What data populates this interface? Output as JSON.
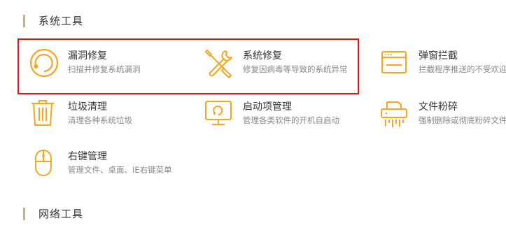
{
  "sections": {
    "system": {
      "title": "系统工具"
    },
    "network": {
      "title": "网络工具"
    }
  },
  "accent_color": "#f5a623",
  "highlight_color": "#e01515",
  "tools": [
    {
      "name": "漏洞修复",
      "desc": "扫描并修复系统漏洞",
      "icon": "refresh-ring-icon"
    },
    {
      "name": "系统修复",
      "desc": "修复因病毒等导致的系统异常",
      "icon": "wrench-screwdriver-icon"
    },
    {
      "name": "弹窗拦截",
      "desc": "拦截程序推送的不受欢迎",
      "icon": "popup-window-icon"
    },
    {
      "name": "垃圾清理",
      "desc": "清理各种系统垃圾",
      "icon": "trash-can-icon"
    },
    {
      "name": "启动项管理",
      "desc": "管理各类软件的开机自启动",
      "icon": "monitor-icon"
    },
    {
      "name": "文件粉碎",
      "desc": "强制删除或彻底粉碎文件",
      "icon": "shredder-icon"
    },
    {
      "name": "右键管理",
      "desc": "管理文件、桌面、IE右键菜单",
      "icon": "mouse-icon"
    }
  ]
}
